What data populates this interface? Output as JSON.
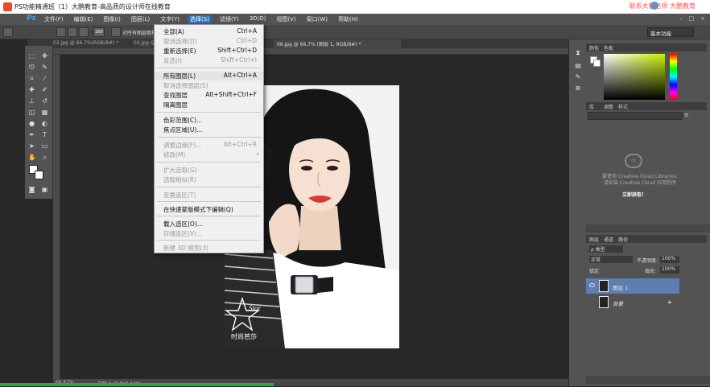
{
  "titlebar": {
    "title": "PS功能精通班（1）大鹏教育-高品质的设计师在线教育",
    "right_text": "联系大鹏老师 大鹏教育"
  },
  "menubar": {
    "logo": "Ps",
    "items": [
      "文件(F)",
      "编辑(E)",
      "图像(I)",
      "图层(L)",
      "文字(Y)",
      "选择(S)",
      "滤镜(T)",
      "3D(D)",
      "视图(V)",
      "窗口(W)",
      "帮助(H)"
    ],
    "active_index": 5,
    "window_controls": [
      "–",
      "□",
      "×"
    ]
  },
  "options": {
    "size_value": "200",
    "option_text": "对所有图层取样",
    "workspace": "基本功能"
  },
  "tabs": [
    {
      "label": "02.jpg @ 66.7%(RGB/8#) *"
    },
    {
      "label": "03.jpg @ 66.7%(RGB/8#) *"
    },
    {
      "label": "06.jpg @ 66.7% (图层 1, RGB/8#) *"
    }
  ],
  "select_menu": {
    "items": [
      {
        "label": "全部(A)",
        "shortcut": "Ctrl+A",
        "enabled": true
      },
      {
        "label": "取消选择(D)",
        "shortcut": "Ctrl+D",
        "enabled": false
      },
      {
        "label": "重新选择(E)",
        "shortcut": "Shift+Ctrl+D",
        "enabled": true
      },
      {
        "label": "反选(I)",
        "shortcut": "Shift+Ctrl+I",
        "enabled": false
      },
      {
        "label": "所有图层(L)",
        "shortcut": "Alt+Ctrl+A",
        "enabled": true
      },
      {
        "label": "取消选择图层(S)",
        "shortcut": "",
        "enabled": false
      },
      {
        "label": "查找图层",
        "shortcut": "Alt+Shift+Ctrl+F",
        "enabled": true
      },
      {
        "label": "隔离图层",
        "shortcut": "",
        "enabled": true
      },
      {
        "label": "色彩范围(C)...",
        "shortcut": "",
        "enabled": true
      },
      {
        "label": "焦点区域(U)...",
        "shortcut": "",
        "enabled": true
      },
      {
        "label": "调整边缘(F)...",
        "shortcut": "Alt+Ctrl+R",
        "enabled": false
      },
      {
        "label": "修改(M)",
        "shortcut": "",
        "enabled": false,
        "submenu": true
      },
      {
        "label": "扩大选取(G)",
        "shortcut": "",
        "enabled": false
      },
      {
        "label": "选取相似(R)",
        "shortcut": "",
        "enabled": false
      },
      {
        "label": "变换选区(T)",
        "shortcut": "",
        "enabled": false
      },
      {
        "label": "在快速蒙版模式下编辑(Q)",
        "shortcut": "",
        "enabled": true
      },
      {
        "label": "载入选区(O)...",
        "shortcut": "",
        "enabled": true
      },
      {
        "label": "存储选区(V)...",
        "shortcut": "",
        "enabled": false
      },
      {
        "label": "新建 3D 模型(3)",
        "shortcut": "",
        "enabled": false
      }
    ]
  },
  "color_panel": {
    "tabs": [
      "颜色",
      "色板"
    ]
  },
  "libraries_panel": {
    "tabs": [
      "库",
      "调整",
      "样式"
    ],
    "message1": "要使用 Creative Cloud Libraries,",
    "message2": "请安装 Creative Cloud 应用程序",
    "link": "立即获取！"
  },
  "layers_panel": {
    "tabs": [
      "图层",
      "通道",
      "路径"
    ],
    "filter": "ρ 类型",
    "blend_mode": "正常",
    "opacity_label": "不透明度:",
    "opacity_value": "100%",
    "lock_label": "锁定:",
    "fill_label": "填充:",
    "fill_value": "100%",
    "layers": [
      {
        "name": "图层 1",
        "selected": true
      },
      {
        "name": "背景",
        "selected": false
      }
    ]
  },
  "status": {
    "zoom": "66.67%",
    "doc": "文档:1.21M/3.44M"
  },
  "photo_overlay": {
    "brand_text": "Star",
    "caption": "时尚芭莎"
  }
}
